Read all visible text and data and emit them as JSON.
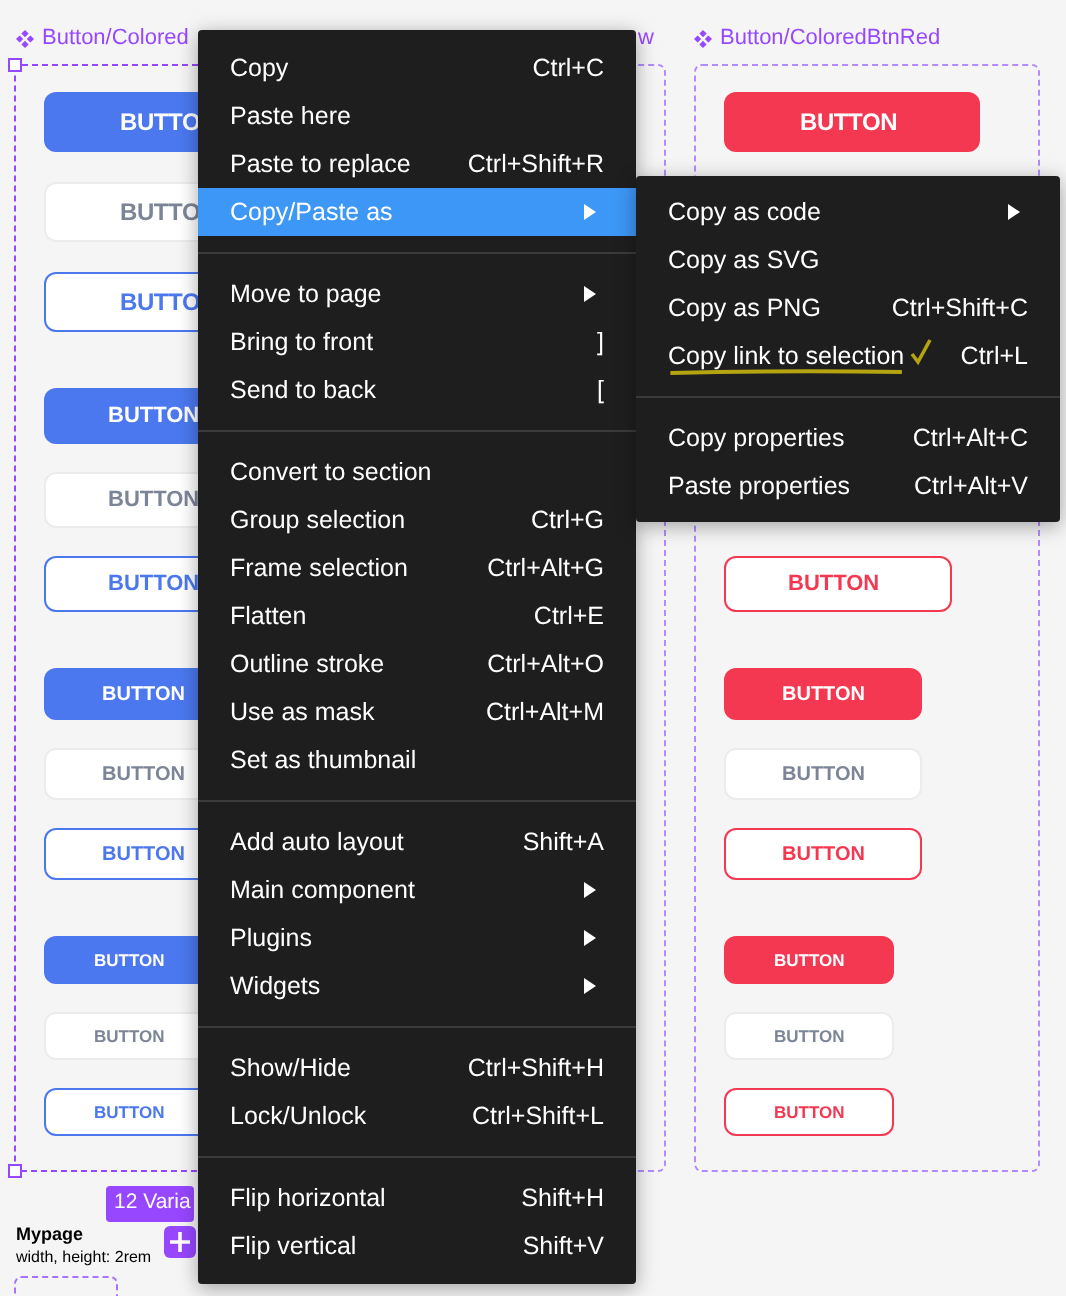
{
  "canvas": {
    "frames": [
      {
        "title": "Button/Colored",
        "color": "#4b78ef",
        "selected": true,
        "groups": [
          {
            "buttons": [
              {
                "label": "BUTTO",
                "kind": "filled"
              },
              {
                "label": "BUTTO",
                "kind": "plain"
              },
              {
                "label": "BUTTO",
                "kind": "outline"
              }
            ]
          },
          {
            "buttons": [
              {
                "label": "BUTTON",
                "kind": "filled"
              },
              {
                "label": "BUTTON",
                "kind": "plain"
              },
              {
                "label": "BUTTON",
                "kind": "outline"
              }
            ]
          },
          {
            "buttons": [
              {
                "label": "BUTTON",
                "kind": "filled"
              },
              {
                "label": "BUTTON",
                "kind": "plain"
              },
              {
                "label": "BUTTON",
                "kind": "outline"
              }
            ]
          },
          {
            "buttons": [
              {
                "label": "BUTTON",
                "kind": "filled"
              },
              {
                "label": "BUTTON",
                "kind": "plain"
              },
              {
                "label": "BUTTON",
                "kind": "outline"
              }
            ]
          }
        ],
        "variants_badge": "12 Varia"
      },
      {
        "title": "w",
        "selected": false
      },
      {
        "title": "Button/ColoredBtnRed",
        "color": "#f43851",
        "selected": false,
        "groups": [
          {
            "buttons": [
              {
                "label": "BUTTON",
                "kind": "filled"
              }
            ]
          },
          {
            "buttons": [
              {
                "label": "BUTTON",
                "kind": "outline"
              }
            ]
          },
          {
            "buttons": [
              {
                "label": "BUTTON",
                "kind": "filled"
              },
              {
                "label": "BUTTON",
                "kind": "plain"
              },
              {
                "label": "BUTTON",
                "kind": "outline"
              }
            ]
          },
          {
            "buttons": [
              {
                "label": "BUTTON",
                "kind": "filled"
              },
              {
                "label": "BUTTON",
                "kind": "plain"
              },
              {
                "label": "BUTTON",
                "kind": "outline"
              }
            ]
          }
        ]
      }
    ],
    "page_info": {
      "name": "Mypage",
      "detail": "width, height: 2rem"
    }
  },
  "context_menu": {
    "sections": [
      [
        {
          "label": "Copy",
          "shortcut": "Ctrl+C",
          "submenu": false,
          "selected": false
        },
        {
          "label": "Paste here",
          "submenu": false,
          "selected": false
        },
        {
          "label": "Paste to replace",
          "shortcut": "Ctrl+Shift+R",
          "submenu": false,
          "selected": false
        },
        {
          "label": "Copy/Paste as",
          "submenu": true,
          "selected": true
        }
      ],
      [
        {
          "label": "Move to page",
          "submenu": true,
          "selected": false
        },
        {
          "label": "Bring to front",
          "shortcut": "]",
          "submenu": false,
          "selected": false
        },
        {
          "label": "Send to back",
          "shortcut": "[",
          "submenu": false,
          "selected": false
        }
      ],
      [
        {
          "label": "Convert to section",
          "submenu": false,
          "selected": false
        },
        {
          "label": "Group selection",
          "shortcut": "Ctrl+G",
          "submenu": false,
          "selected": false
        },
        {
          "label": "Frame selection",
          "shortcut": "Ctrl+Alt+G",
          "submenu": false,
          "selected": false
        },
        {
          "label": "Flatten",
          "shortcut": "Ctrl+E",
          "submenu": false,
          "selected": false
        },
        {
          "label": "Outline stroke",
          "shortcut": "Ctrl+Alt+O",
          "submenu": false,
          "selected": false
        },
        {
          "label": "Use as mask",
          "shortcut": "Ctrl+Alt+M",
          "submenu": false,
          "selected": false
        },
        {
          "label": "Set as thumbnail",
          "submenu": false,
          "selected": false
        }
      ],
      [
        {
          "label": "Add auto layout",
          "shortcut": "Shift+A",
          "submenu": false,
          "selected": false
        },
        {
          "label": "Main component",
          "submenu": true,
          "selected": false
        },
        {
          "label": "Plugins",
          "submenu": true,
          "selected": false
        },
        {
          "label": "Widgets",
          "submenu": true,
          "selected": false
        }
      ],
      [
        {
          "label": "Show/Hide",
          "shortcut": "Ctrl+Shift+H",
          "submenu": false,
          "selected": false
        },
        {
          "label": "Lock/Unlock",
          "shortcut": "Ctrl+Shift+L",
          "submenu": false,
          "selected": false
        }
      ],
      [
        {
          "label": "Flip horizontal",
          "shortcut": "Shift+H",
          "submenu": false,
          "selected": false
        },
        {
          "label": "Flip vertical",
          "shortcut": "Shift+V",
          "submenu": false,
          "selected": false
        }
      ]
    ]
  },
  "submenu": {
    "sections": [
      [
        {
          "label": "Copy as code",
          "submenu": true,
          "annotated": false
        },
        {
          "label": "Copy as SVG",
          "submenu": false,
          "annotated": false
        },
        {
          "label": "Copy as PNG",
          "shortcut": "Ctrl+Shift+C",
          "submenu": false,
          "annotated": false
        },
        {
          "label": "Copy link to selection",
          "shortcut": "Ctrl+L",
          "submenu": false,
          "annotated": true
        }
      ],
      [
        {
          "label": "Copy properties",
          "shortcut": "Ctrl+Alt+C",
          "submenu": false,
          "annotated": false
        },
        {
          "label": "Paste properties",
          "shortcut": "Ctrl+Alt+V",
          "submenu": false,
          "annotated": false
        }
      ]
    ]
  }
}
